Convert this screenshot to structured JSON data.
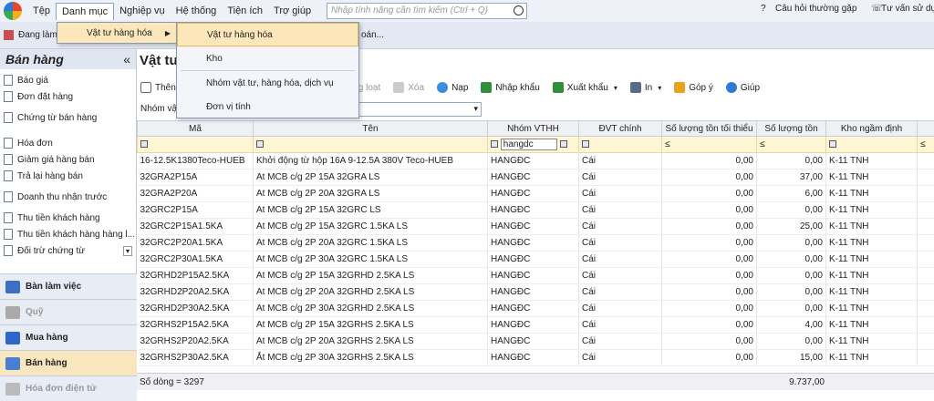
{
  "menubar": {
    "items": [
      "Tệp",
      "Danh mục",
      "Nghiệp vụ",
      "Hệ thống",
      "Tiện ích",
      "Trợ giúp"
    ],
    "search_placeholder": "Nhập tính năng cần tìm kiếm (Ctrl + Q)",
    "faq": "Câu hỏi thường gặp",
    "advice": "Tư vấn sử dụ"
  },
  "toolbar1": {
    "working": "Đang làm",
    "truncated": "oán..."
  },
  "sidebar": {
    "title": "Bán hàng",
    "groups": [
      [
        "Báo giá",
        "Đơn đặt hàng"
      ],
      [
        "Chứng từ bán hàng"
      ],
      [
        "Hóa đơn",
        "Giảm giá hàng bán",
        "Trả lại hàng bán"
      ],
      [
        "Doanh thu nhận trước"
      ],
      [
        "Thu tiền khách hàng",
        "Thu tiền khách hàng hàng l...",
        "Đối trừ chứng từ"
      ]
    ],
    "modules": [
      "Bàn làm việc",
      "Quỹ",
      "Mua hàng",
      "Bán hàng",
      "Hóa đơn điện tử"
    ]
  },
  "main": {
    "title": "Vật tư",
    "filter_label": "Nhóm vậ"
  },
  "toolbar2": {
    "add": "Thên",
    "batch": "g loạt",
    "delete": "Xóa",
    "refresh": "Nạp",
    "import": "Nhập khẩu",
    "export": "Xuất khẩu",
    "print": "In",
    "feedback": "Góp ý",
    "help": "Giúp"
  },
  "grid": {
    "headers": [
      "Mã",
      "Tên",
      "Nhóm VTHH",
      "ĐVT chính",
      "Số lượng tồn tối thiểu",
      "Số lượng tồn",
      "Kho ngầm định"
    ],
    "filter_group": "hangdc",
    "rows": [
      [
        "16-12.5K1380Teco-HUEB",
        "Khởi động từ hộp 16A 9-12.5A 380V Teco-HUEB",
        "HANGĐC",
        "Cái",
        "0,00",
        "0,00",
        "K-11 TNH"
      ],
      [
        "32GRA2P15A",
        "At MCB c/g 2P 15A 32GRA LS",
        "HANGĐC",
        "Cái",
        "0,00",
        "37,00",
        "K-11 TNH"
      ],
      [
        "32GRA2P20A",
        "At MCB c/g 2P 20A 32GRA LS",
        "HANGĐC",
        "Cái",
        "0,00",
        "6,00",
        "K-11 TNH"
      ],
      [
        "32GRC2P15A",
        "At MCB c/g 2P 15A 32GRC LS",
        "HANGĐC",
        "Cái",
        "0,00",
        "0,00",
        "K-11 TNH"
      ],
      [
        "32GRC2P15A1.5KA",
        "At MCB c/g 2P 15A 32GRC 1.5KA LS",
        "HANGĐC",
        "Cái",
        "0,00",
        "25,00",
        "K-11 TNH"
      ],
      [
        "32GRC2P20A1.5KA",
        "At MCB c/g 2P 20A 32GRC 1.5KA LS",
        "HANGĐC",
        "Cái",
        "0,00",
        "0,00",
        "K-11 TNH"
      ],
      [
        "32GRC2P30A1.5KA",
        "At MCB c/g 2P 30A 32GRC 1.5KA LS",
        "HANGĐC",
        "Cái",
        "0,00",
        "0,00",
        "K-11 TNH"
      ],
      [
        "32GRHD2P15A2.5KA",
        "At MCB c/g 2P 15A 32GRHD 2.5KA LS",
        "HANGĐC",
        "Cái",
        "0,00",
        "0,00",
        "K-11 TNH"
      ],
      [
        "32GRHD2P20A2.5KA",
        "At MCB c/g 2P 20A 32GRHD 2.5KA LS",
        "HANGĐC",
        "Cái",
        "0,00",
        "0,00",
        "K-11 TNH"
      ],
      [
        "32GRHD2P30A2.5KA",
        "At MCB c/g 2P 30A 32GRHD 2.5KA LS",
        "HANGĐC",
        "Cái",
        "0,00",
        "0,00",
        "K-11 TNH"
      ],
      [
        "32GRHS2P15A2.5KA",
        "At MCB c/g 2P 15A 32GRHS 2.5KA LS",
        "HANGĐC",
        "Cái",
        "0,00",
        "4,00",
        "K-11 TNH"
      ],
      [
        "32GRHS2P20A2.5KA",
        "At MCB c/g 2P 20A 32GRHS 2.5KA LS",
        "HANGĐC",
        "Cái",
        "0,00",
        "0,00",
        "K-11 TNH"
      ],
      [
        "32GRHS2P30A2.5KA",
        "Ắt MCB c/g 2P 30A 32GRHS 2.5KA LS",
        "HANGĐC",
        "Cái",
        "0,00",
        "15,00",
        "K-11 TNH"
      ]
    ],
    "row_count": "Số dòng = 3297",
    "total_stock": "9.737,00"
  },
  "dropdown": {
    "submenu": "Vật tư hàng hóa",
    "items": [
      "Vật tư hàng hóa",
      "Kho",
      "Nhóm vật tư, hàng hóa, dịch vụ",
      "Đơn vị tính"
    ]
  }
}
